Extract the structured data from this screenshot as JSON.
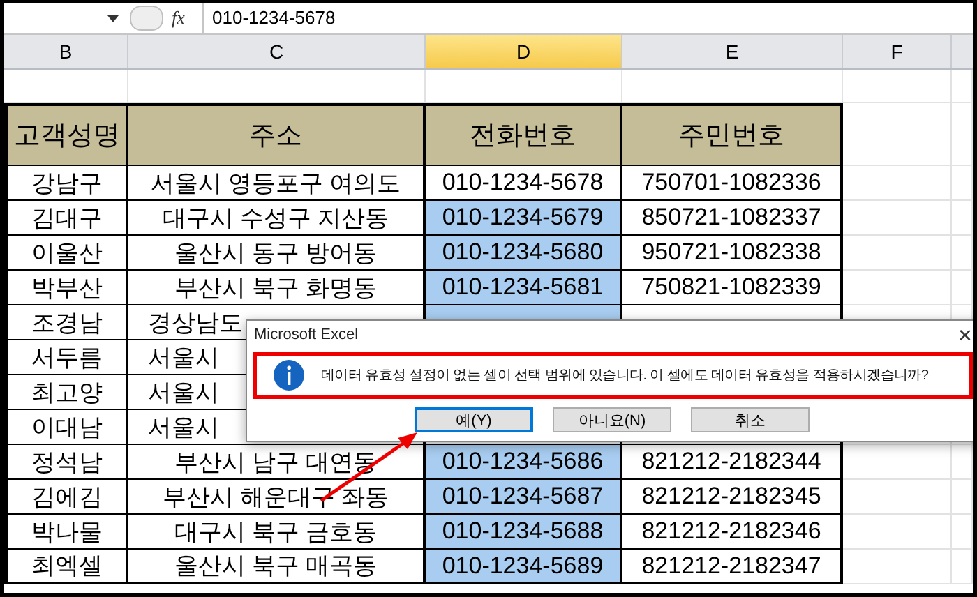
{
  "formula_bar": {
    "fx": "fx",
    "value": "010-1234-5678"
  },
  "columns": [
    {
      "label": "B",
      "selected": false
    },
    {
      "label": "C",
      "selected": false
    },
    {
      "label": "D",
      "selected": true
    },
    {
      "label": "E",
      "selected": false
    },
    {
      "label": "F",
      "selected": false
    }
  ],
  "table": {
    "headers": [
      "고객성명",
      "주소",
      "전화번호",
      "주민번호"
    ],
    "rows": [
      {
        "name": "강남구",
        "address": "서울시 영등포구 여의도",
        "phone": "010-1234-5678",
        "id": "750701-1082336",
        "selected": false
      },
      {
        "name": "김대구",
        "address": "대구시 수성구 지산동",
        "phone": "010-1234-5679",
        "id": "850721-1082337",
        "selected": true
      },
      {
        "name": "이울산",
        "address": "울산시 동구 방어동",
        "phone": "010-1234-5680",
        "id": "950721-1082338",
        "selected": true
      },
      {
        "name": "박부산",
        "address": "부산시 북구 화명동",
        "phone": "010-1234-5681",
        "id": "750821-1082339",
        "selected": true
      },
      {
        "name": "조경남",
        "address": "경상남도",
        "selected": true
      },
      {
        "name": "서두름",
        "address": "서울시"
      },
      {
        "name": "최고양",
        "address": "서울시"
      },
      {
        "name": "이대남",
        "address": "서울시"
      },
      {
        "name": "정석남",
        "address": "부산시 남구 대연동",
        "phone": "010-1234-5686",
        "id": "821212-2182344",
        "selected": true
      },
      {
        "name": "김에김",
        "address": "부산시 해운대구 좌동",
        "phone": "010-1234-5687",
        "id": "821212-2182345",
        "selected": true
      },
      {
        "name": "박나물",
        "address": "대구시 북구 금호동",
        "phone": "010-1234-5688",
        "id": "821212-2182346",
        "selected": true
      },
      {
        "name": "최엑셀",
        "address": "울산시 북구 매곡동",
        "phone": "010-1234-5689",
        "id": "821212-2182347",
        "selected": true
      }
    ]
  },
  "dialog": {
    "title": "Microsoft Excel",
    "close": "✕",
    "message": "데이터 유효성 설정이 없는 셀이 선택 범위에 있습니다. 이 셀에도 데이터 유효성을 적용하시겠습니까?",
    "buttons": [
      {
        "label": "예(Y)",
        "selected": true
      },
      {
        "label": "아니요(N)",
        "selected": false
      },
      {
        "label": "취소",
        "selected": false
      }
    ]
  }
}
